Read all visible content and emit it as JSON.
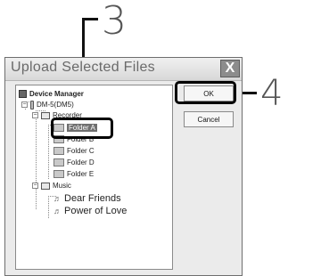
{
  "callouts": {
    "select_folder": "3",
    "ok_button": "4"
  },
  "dialog": {
    "title": "Upload Selected Files",
    "close_label": "X",
    "ok_label": "OK",
    "cancel_label": "Cancel"
  },
  "tree": {
    "root": "Device Manager",
    "device": "DM-5(DM5)",
    "recorder_folder": "Recorder",
    "folders": [
      "Folder A",
      "Folder B",
      "Folder C",
      "Folder D",
      "Folder E"
    ],
    "selected": "Folder A",
    "music_folder": "Music",
    "songs": [
      "Dear Friends",
      "Power of Love"
    ]
  }
}
